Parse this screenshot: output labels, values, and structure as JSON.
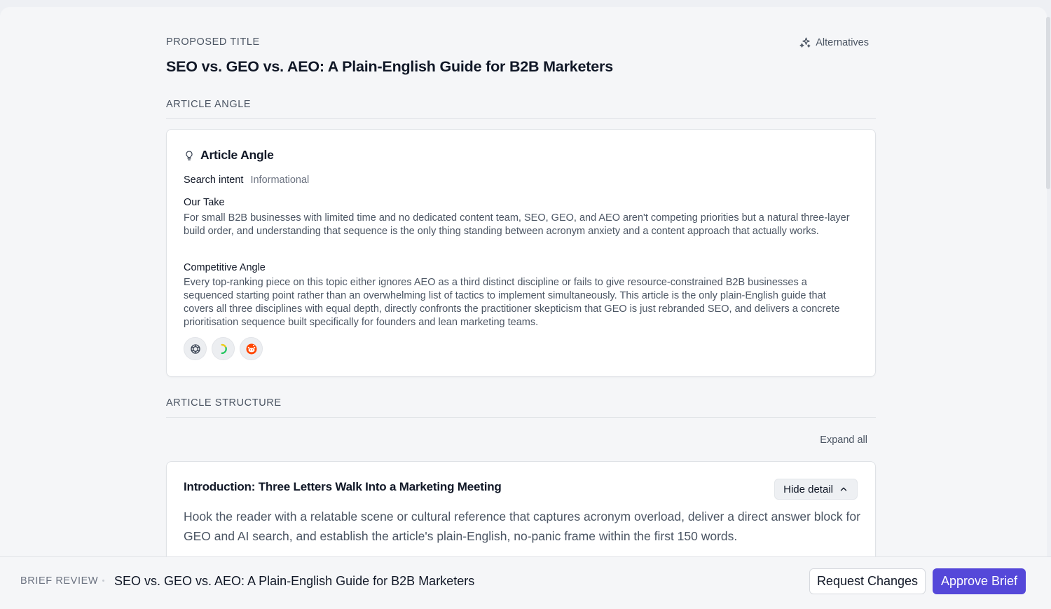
{
  "header": {
    "proposed_label": "PROPOSED TITLE",
    "proposed_title": "SEO vs. GEO vs. AEO: A Plain-English Guide for B2B Marketers",
    "alternatives_label": "Alternatives",
    "alternatives_icon": "sparkles-icon"
  },
  "angle": {
    "section_label": "ARTICLE ANGLE",
    "card_title": "Article Angle",
    "card_icon": "lightbulb-icon",
    "intent_key": "Search intent",
    "intent_value": "Informational",
    "our_take_title": "Our Take",
    "our_take_text": "For small B2B businesses with limited time and no dedicated content team, SEO, GEO, and AEO aren't competing priorities but a natural three-layer build order, and understanding that sequence is the only thing standing between acronym anxiety and a content approach that actually works.",
    "competitive_title": "Competitive Angle",
    "competitive_text": "Every top-ranking piece on this topic either ignores AEO as a third distinct discipline or fails to give resource-constrained B2B businesses a sequenced starting point rather than an overwhelming list of tactics to implement simultaneously. This article is the only plain-English guide that covers all three disciplines with equal depth, directly confronts the practitioner skepticism that GEO is just rebranded SEO, and delivers a concrete prioritisation sequence built specifically for founders and lean marketing teams.",
    "sources": [
      {
        "icon": "openai-icon",
        "color": "#374151"
      },
      {
        "icon": "perplexity-icon",
        "color": "#22c55e"
      },
      {
        "icon": "reddit-icon",
        "color": "#ff4500"
      }
    ]
  },
  "structure": {
    "section_label": "ARTICLE STRUCTURE",
    "expand_all_label": "Expand all",
    "sections": [
      {
        "title": "Introduction: Three Letters Walk Into a Marketing Meeting",
        "toggle_label": "Hide detail",
        "description": "Hook the reader with a relatable scene or cultural reference that captures acronym overload, deliver a direct answer block for GEO and AI search, and establish the article's plain-English, no-panic frame within the first 150 words."
      }
    ]
  },
  "footer": {
    "label": "BRIEF REVIEW",
    "title": "SEO vs. GEO vs. AEO: A Plain-English Guide for B2B Marketers",
    "request_changes_label": "Request Changes",
    "approve_label": "Approve Brief",
    "accent_color": "#5548d9"
  }
}
